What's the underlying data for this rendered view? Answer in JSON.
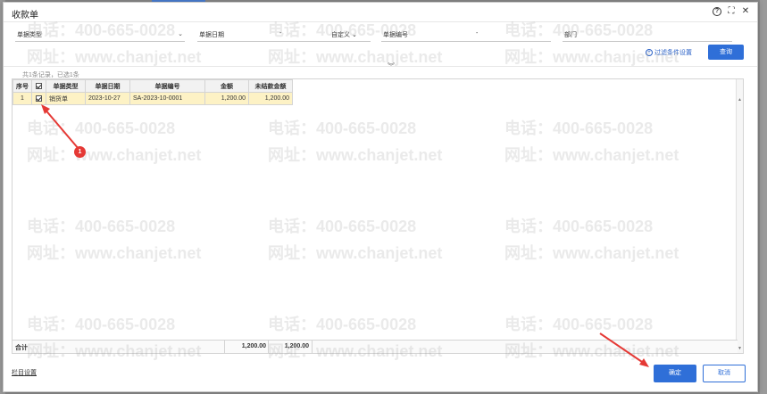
{
  "dialog": {
    "title": "收款单"
  },
  "filters": {
    "bill_type_label": "单据类型",
    "bill_date_label": "单据日期",
    "date_range_sep": "-",
    "date_mode": "自定义",
    "bill_no_label": "单据编号",
    "bill_no_sep": "-",
    "dept_label": "部门",
    "filter_setting": "过滤条件设置",
    "query_button": "查询"
  },
  "record_count": "共1条记录，已选1条",
  "grid": {
    "columns": [
      "序号",
      "",
      "单据类型",
      "单据日期",
      "单据编号",
      "金额",
      "未结款金额"
    ],
    "rows": [
      {
        "index": "1",
        "checked": true,
        "type": "销货单",
        "date": "2023-10-27",
        "no": "SA-2023-10-0001",
        "amount": "1,200.00",
        "unsettled": "1,200.00"
      }
    ],
    "total": {
      "label": "合计",
      "amount": "1,200.00",
      "unsettled": "1,200.00"
    }
  },
  "footer": {
    "column_setting": "栏目设置",
    "ok_button": "确定",
    "cancel_button": "取消"
  },
  "watermark": {
    "phone": "电话：400-665-0028",
    "site": "网址：www.chanjet.net"
  },
  "annotation": {
    "badge": "1",
    "color": "#e53935"
  }
}
